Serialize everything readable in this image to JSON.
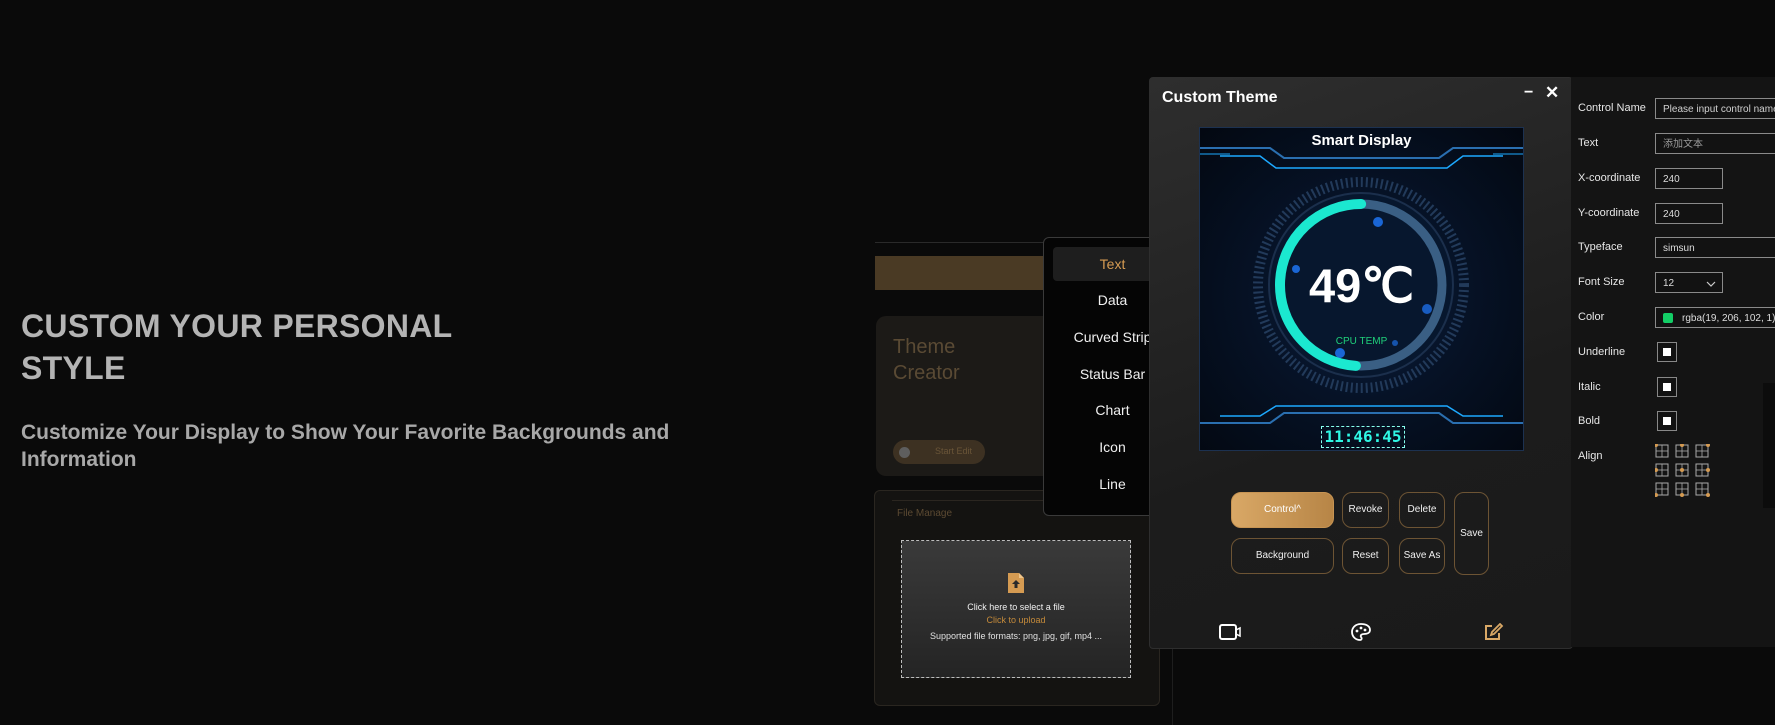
{
  "hero": {
    "heading": "CUSTOM YOUR PERSONAL\nSTYLE",
    "subheading": "Customize Your Display to Show Your Favorite Backgrounds and Information"
  },
  "theme_creator": {
    "title": "Theme\nCreator",
    "start_edit": "Start Edit",
    "file_manage": "File Manage",
    "upload_line1": "Click here to select a file",
    "upload_line2": "Click to upload",
    "upload_line3": "Supported file formats: png, jpg, gif, mp4 ..."
  },
  "dropdown": {
    "items": [
      "Text",
      "Data",
      "Curved Strip",
      "Status Bar",
      "Chart",
      "Icon",
      "Line"
    ],
    "selected": "Text"
  },
  "window": {
    "title": "Custom Theme",
    "minimize_glyph": "−",
    "close_glyph": "✕",
    "preview": {
      "title": "Smart Display",
      "temp_value": "49℃",
      "temp_label": "CPU TEMP",
      "clock": "11:46:45",
      "gauge_fraction": 0.49
    },
    "buttons": {
      "control": "Control",
      "control_chevron": "^",
      "background": "Background",
      "revoke": "Revoke",
      "reset": "Reset",
      "delete": "Delete",
      "save_as": "Save As",
      "save": "Save"
    },
    "bottom_icons": [
      "video-icon",
      "palette-icon",
      "edit-icon"
    ]
  },
  "properties": {
    "control_name_label": "Control Name",
    "control_name_placeholder": "Please input control name",
    "text_label": "Text",
    "text_value": "添加文本",
    "x_label": "X-coordinate",
    "x_value": "240",
    "y_label": "Y-coordinate",
    "y_value": "240",
    "typeface_label": "Typeface",
    "typeface_value": "simsun",
    "font_size_label": "Font Size",
    "font_size_value": "12",
    "color_label": "Color",
    "color_value": "rgba(19, 206, 102, 1)",
    "color_swatch": "#13ce66",
    "underline_label": "Underline",
    "italic_label": "Italic",
    "bold_label": "Bold",
    "align_label": "Align"
  },
  "colors": {
    "accent": "#d9a866",
    "background": "#0a0a0a",
    "gauge": "#1be8d0",
    "clock": "#2ff7e4"
  }
}
